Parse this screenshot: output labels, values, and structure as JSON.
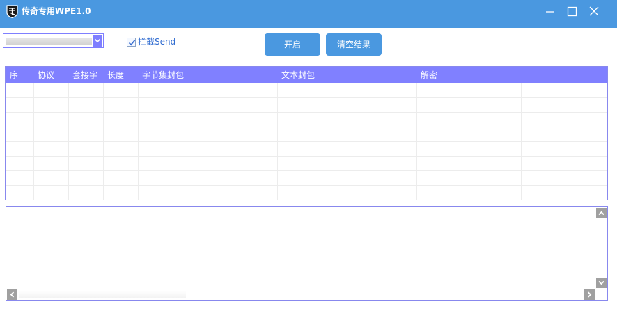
{
  "window": {
    "title": "传奇专用WPE1.0",
    "accent_color": "#4a98e0",
    "controls": [
      "minimize-icon",
      "maximize-icon",
      "close-icon"
    ]
  },
  "toolbar": {
    "adapter_select": {
      "selected": ""
    },
    "intercept_checkbox": {
      "label": "拦截Send",
      "checked": true
    },
    "start_label": "开启",
    "clear_label": "清空结果"
  },
  "packet_list": {
    "header_color": "#8080ff",
    "columns": [
      "序",
      "协议",
      "套接字",
      "长度",
      "字节集封包",
      "文本封包",
      "解密"
    ],
    "rows": []
  },
  "log": {
    "text": ""
  }
}
